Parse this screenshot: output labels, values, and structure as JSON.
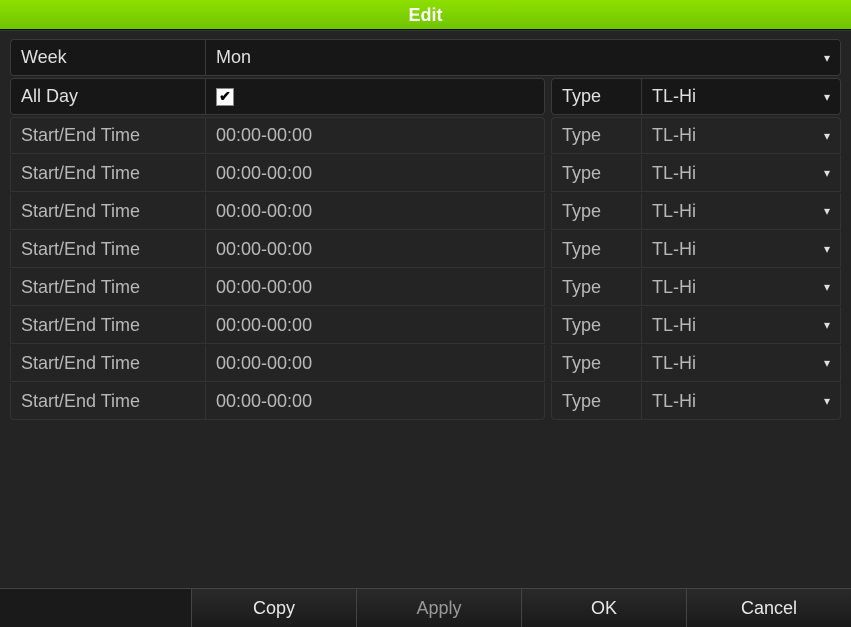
{
  "title": "Edit",
  "week_label": "Week",
  "week_value": "Mon",
  "allday_label": "All Day",
  "allday_checked": true,
  "type_label": "Type",
  "active_type_value": "TL-Hi",
  "time_rows": [
    {
      "label": "Start/End Time",
      "value": "00:00-00:00",
      "type_label": "Type",
      "type_value": "TL-Hi"
    },
    {
      "label": "Start/End Time",
      "value": "00:00-00:00",
      "type_label": "Type",
      "type_value": "TL-Hi"
    },
    {
      "label": "Start/End Time",
      "value": "00:00-00:00",
      "type_label": "Type",
      "type_value": "TL-Hi"
    },
    {
      "label": "Start/End Time",
      "value": "00:00-00:00",
      "type_label": "Type",
      "type_value": "TL-Hi"
    },
    {
      "label": "Start/End Time",
      "value": "00:00-00:00",
      "type_label": "Type",
      "type_value": "TL-Hi"
    },
    {
      "label": "Start/End Time",
      "value": "00:00-00:00",
      "type_label": "Type",
      "type_value": "TL-Hi"
    },
    {
      "label": "Start/End Time",
      "value": "00:00-00:00",
      "type_label": "Type",
      "type_value": "TL-Hi"
    },
    {
      "label": "Start/End Time",
      "value": "00:00-00:00",
      "type_label": "Type",
      "type_value": "TL-Hi"
    }
  ],
  "buttons": {
    "copy": "Copy",
    "apply": "Apply",
    "ok": "OK",
    "cancel": "Cancel"
  }
}
